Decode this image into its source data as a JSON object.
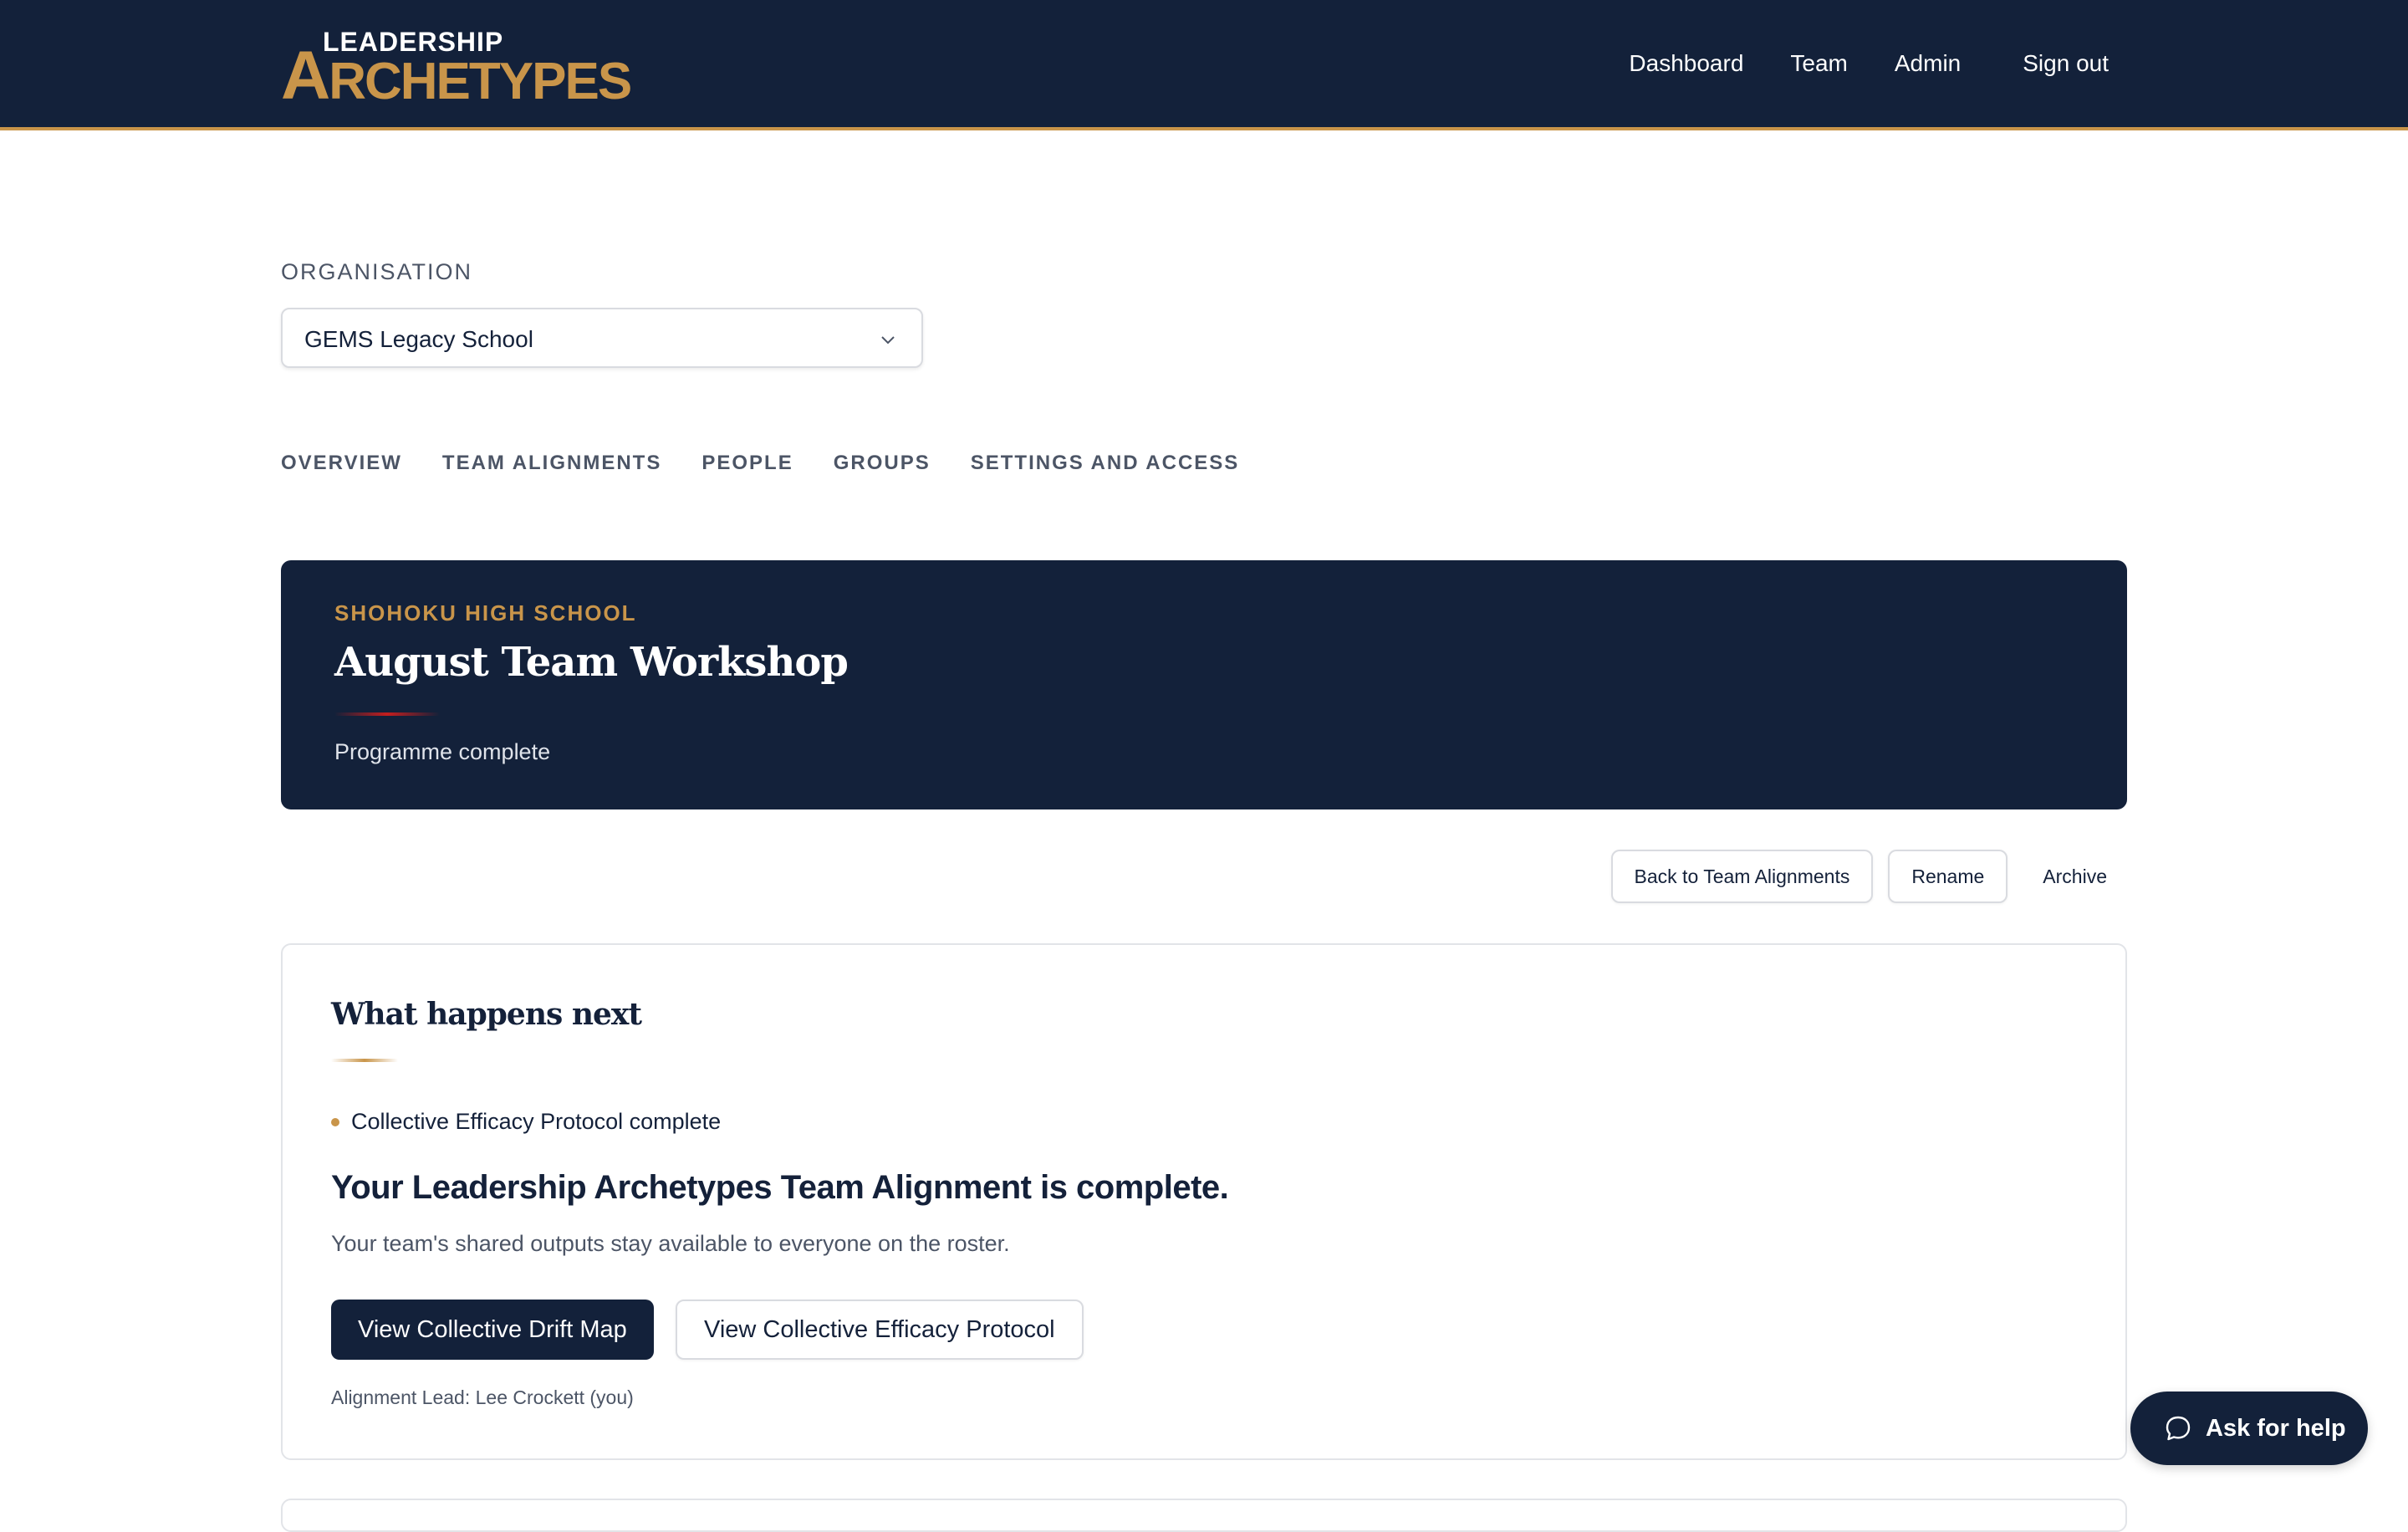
{
  "header": {
    "logo_top": "LEADERSHIP",
    "logo_bottom_cap": "A",
    "logo_bottom_rest": "RCHETYPES",
    "nav": [
      "Dashboard",
      "Team",
      "Admin"
    ],
    "signout": "Sign out"
  },
  "organisation": {
    "label": "ORGANISATION",
    "selected": "GEMS Legacy School"
  },
  "tabs": [
    "OVERVIEW",
    "TEAM ALIGNMENTS",
    "PEOPLE",
    "GROUPS",
    "SETTINGS AND ACCESS"
  ],
  "hero": {
    "kicker": "SHOHOKU HIGH SCHOOL",
    "title": "August Team Workshop",
    "status": "Programme complete"
  },
  "actions": {
    "back": "Back to Team Alignments",
    "rename": "Rename",
    "archive": "Archive"
  },
  "next": {
    "heading": "What happens next",
    "bullet": "Collective Efficacy Protocol complete",
    "big": "Your Leadership Archetypes Team Alignment is complete.",
    "sub": "Your team's shared outputs stay available to everyone on the roster.",
    "primary_button": "View Collective Drift Map",
    "secondary_button": "View Collective Efficacy Protocol",
    "lead": "Alignment Lead: Lee Crockett (you)"
  },
  "help": {
    "label": "Ask for help",
    "icon": "chat-bubble-icon"
  },
  "colors": {
    "navy": "#13213a",
    "gold": "#c9954a",
    "red_accent": "#c41e1e"
  }
}
